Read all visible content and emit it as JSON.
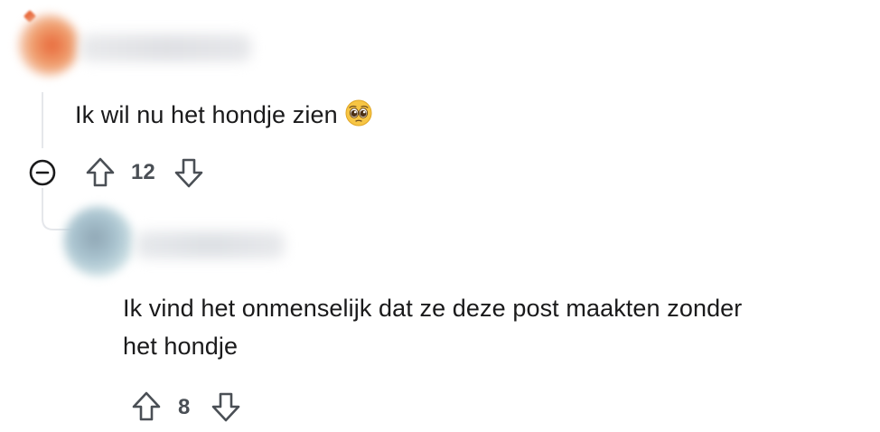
{
  "comments": [
    {
      "text": "Ik wil nu het hondje zien",
      "emoji": "pleading-face",
      "votes": "12"
    },
    {
      "text_line1": "Ik vind het onmenselijk dat ze deze post maakten zonder",
      "text_line2": "het hondje",
      "votes": "8"
    }
  ],
  "colors": {
    "text": "#1a1a1b",
    "icon": "#4a4f55",
    "thread_line": "#e5e7eb",
    "avatar1": "#e8683a",
    "avatar2": "#9ab8c8"
  }
}
